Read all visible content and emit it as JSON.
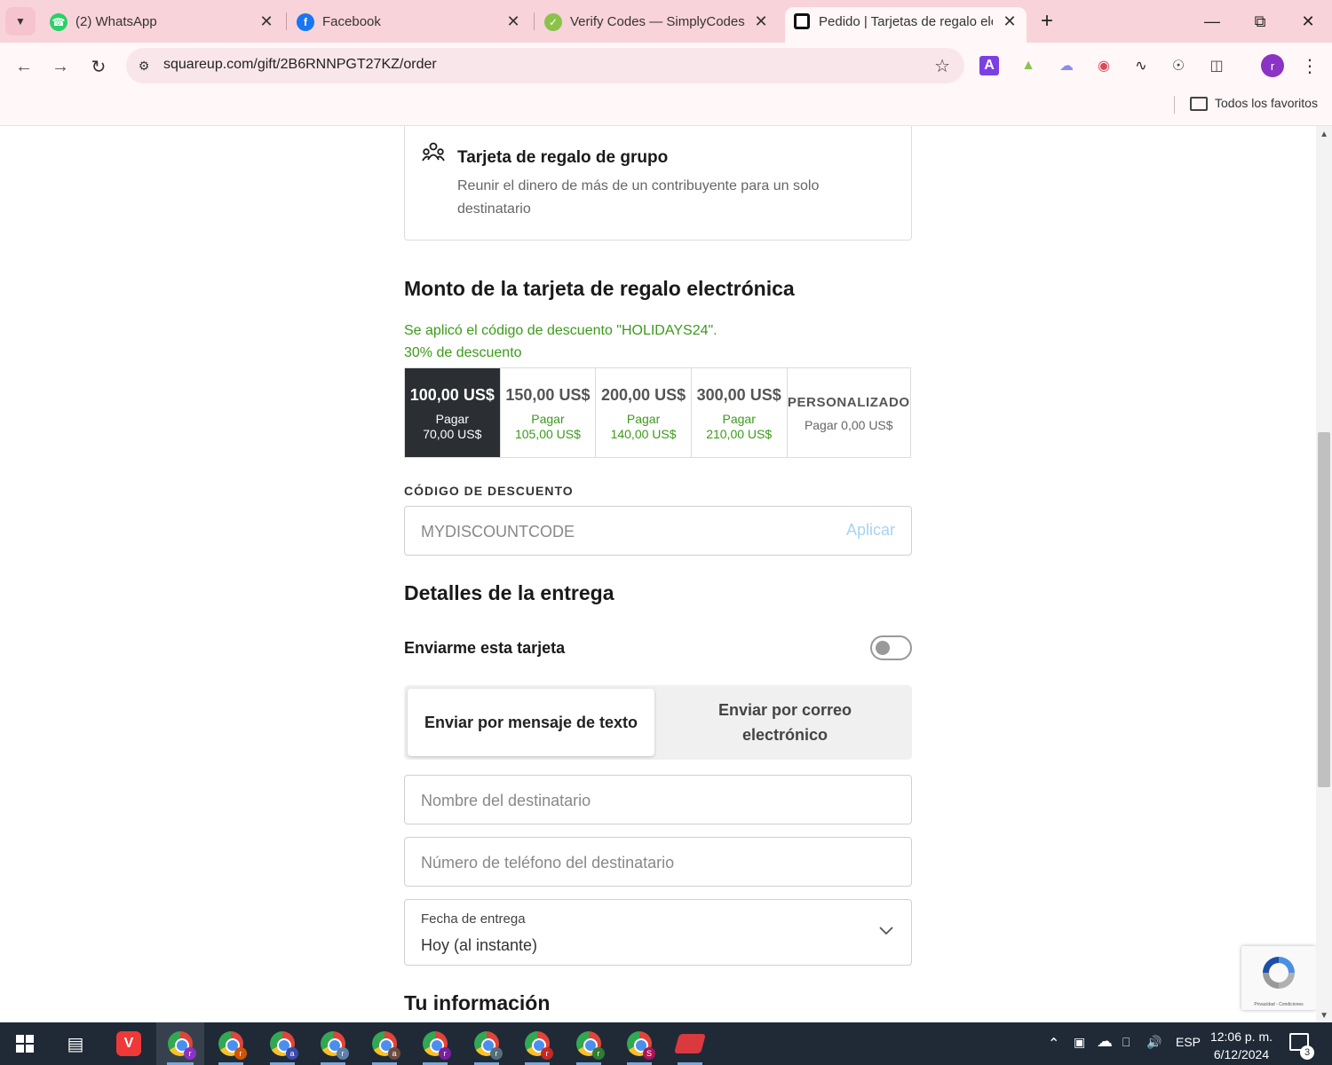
{
  "browser": {
    "tabs": [
      {
        "title": "(2) WhatsApp",
        "icon": "whatsapp-icon",
        "color": "#25d366"
      },
      {
        "title": "Facebook",
        "icon": "facebook-icon",
        "color": "#1877f2"
      },
      {
        "title": "Verify Codes — SimplyCodes",
        "icon": "simplycodes-icon",
        "color": "#8bc34a"
      },
      {
        "title": "Pedido | Tarjetas de regalo elect",
        "icon": "square-icon",
        "color": "#111111"
      }
    ],
    "url": "squareup.com/gift/2B6RNNPGT27KZ/order",
    "bookmarks_label": "Todos los favoritos",
    "profile_initial": "r"
  },
  "group_card": {
    "title": "Tarjeta de regalo de grupo",
    "description": "Reunir el dinero de más de un contribuyente para un solo destinatario"
  },
  "amount_section": {
    "title": "Monto de la tarjeta de regalo electrónica",
    "discount_applied": "Se aplicó el código de descuento \"HOLIDAYS24\".",
    "discount_percent": "30% de descuento",
    "options": [
      {
        "value": "100,00 US$",
        "pay_label": "Pagar",
        "price": "70,00 US$",
        "selected": true
      },
      {
        "value": "150,00 US$",
        "pay_label": "Pagar",
        "price": "105,00 US$",
        "selected": false
      },
      {
        "value": "200,00 US$",
        "pay_label": "Pagar",
        "price": "140,00 US$",
        "selected": false
      },
      {
        "value": "300,00 US$",
        "pay_label": "Pagar",
        "price": "210,00 US$",
        "selected": false
      }
    ],
    "custom": {
      "value": "PERSONALIZADO",
      "price": "Pagar 0,00 US$"
    }
  },
  "discount_code": {
    "label": "CÓDIGO DE DESCUENTO",
    "placeholder": "MYDISCOUNTCODE",
    "apply_label": "Aplicar"
  },
  "delivery": {
    "title": "Detalles de la entrega",
    "send_to_me_label": "Enviarme esta tarjeta",
    "send_to_me_on": false,
    "method_text": "Enviar por mensaje de texto",
    "method_email": "Enviar por correo electrónico",
    "recipient_name_placeholder": "Nombre del destinatario",
    "recipient_phone_placeholder": "Número de teléfono del destinatario",
    "date_label": "Fecha de entrega",
    "date_value": "Hoy (al instante)"
  },
  "your_info": {
    "title": "Tu información"
  },
  "recaptcha": {
    "footer": "Privacidad - Condiciones"
  },
  "taskbar": {
    "language": "ESP",
    "time": "12:06 p. m.",
    "date": "6/12/2024",
    "notifications": "3"
  }
}
